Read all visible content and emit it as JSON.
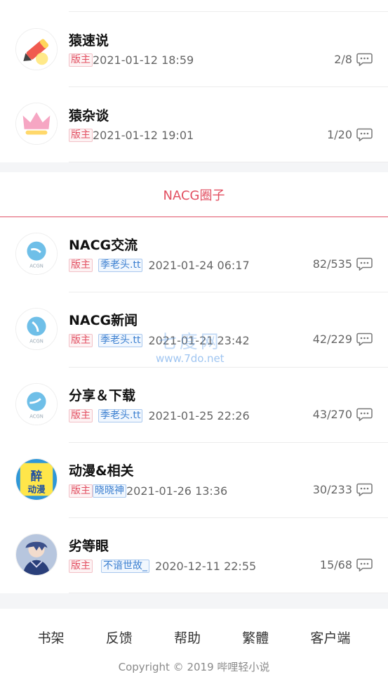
{
  "pinned_forums": [
    {
      "title": "猿速说",
      "admin_tag": "版主",
      "time": "2021-01-12 18:59",
      "stats": "2/8"
    },
    {
      "title": "猿杂谈",
      "admin_tag": "版主",
      "time": "2021-01-12 19:01",
      "stats": "1/20"
    }
  ],
  "group": {
    "title": "NACG圈子"
  },
  "forums": [
    {
      "title": "NACG交流",
      "admin_tag": "版主",
      "user": "季老头.tt",
      "time": "2021-01-24 06:17",
      "stats": "82/535"
    },
    {
      "title": "NACG新闻",
      "admin_tag": "版主",
      "user": "季老头.tt",
      "time": "2021-01-21 23:42",
      "stats": "42/229"
    },
    {
      "title": "分享＆下载",
      "admin_tag": "版主",
      "user": "季老头.tt",
      "time": "2021-01-25 22:26",
      "stats": "43/270"
    },
    {
      "title": "动漫&相关",
      "admin_tag": "版主",
      "user": "晓晓神",
      "time": "2021-01-26 13:36",
      "stats": "30/233"
    },
    {
      "title": "劣等眼",
      "admin_tag": "版主",
      "user": "不谙世故_",
      "time": "2020-12-11 22:55",
      "stats": "15/68"
    }
  ],
  "watermark": {
    "main": "七度网",
    "sub": "www.7do.net"
  },
  "footer": {
    "links": [
      "书架",
      "反馈",
      "帮助",
      "繁體",
      "客户端"
    ],
    "copyright": "Copyright © 2019 哔哩轻小说"
  },
  "icons": {
    "comment": "comment-bubble-icon"
  },
  "colors": {
    "accent": "#e24f61",
    "link_blue": "#3b7fd0"
  }
}
